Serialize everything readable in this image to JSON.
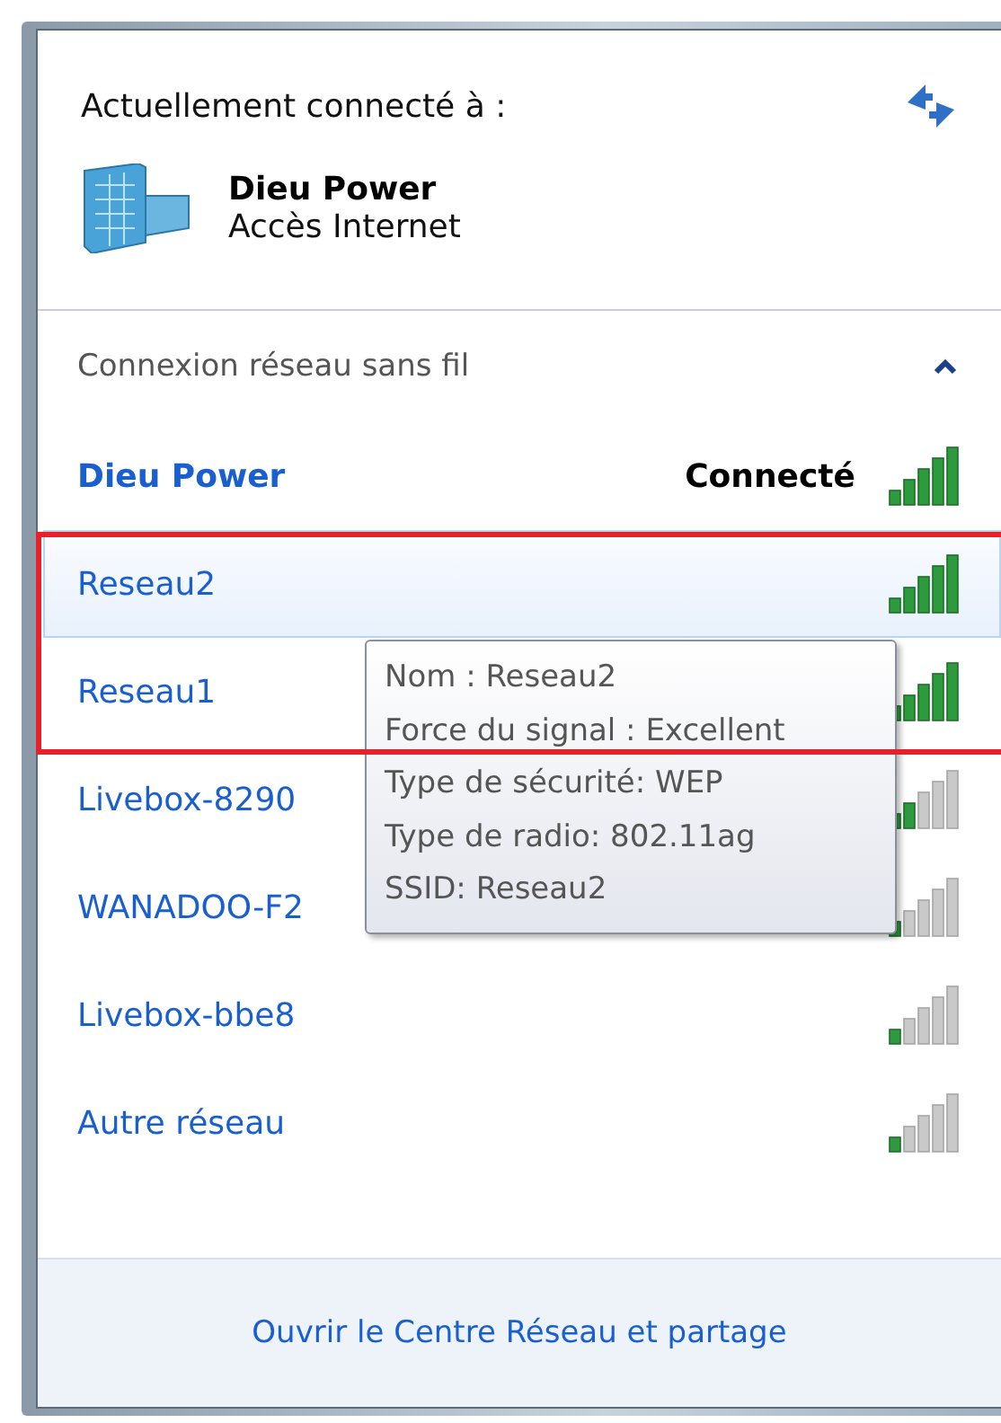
{
  "header": {
    "title": "Actuellement connecté à :",
    "network_name": "Dieu Power",
    "access": "Accès Internet"
  },
  "section": {
    "title": "Connexion réseau sans fil",
    "expanded": true
  },
  "networks": [
    {
      "name": "Dieu Power",
      "connected": true,
      "status": "Connecté",
      "highlighted": false,
      "kind": "strong"
    },
    {
      "name": "Reseau2",
      "connected": false,
      "highlighted": true,
      "kind": "strong"
    },
    {
      "name": "Reseau1",
      "connected": false,
      "highlighted": false,
      "kind": "strong"
    },
    {
      "name": "Livebox-8290",
      "connected": false,
      "highlighted": false,
      "kind": "fair"
    },
    {
      "name": "WANADOO-F2",
      "connected": false,
      "highlighted": false,
      "kind": "weak"
    },
    {
      "name": "Livebox-bbe8",
      "connected": false,
      "highlighted": false,
      "kind": "weak"
    },
    {
      "name": "Autre réseau",
      "connected": false,
      "highlighted": false,
      "kind": "weak"
    }
  ],
  "tooltip": [
    "Nom : Reseau2",
    "Force du signal : Excellent",
    "Type de sécurité: WEP",
    "Type de radio: 802.11ag",
    "SSID: Reseau2"
  ],
  "footer": {
    "link": "Ouvrir le Centre Réseau et partage"
  }
}
